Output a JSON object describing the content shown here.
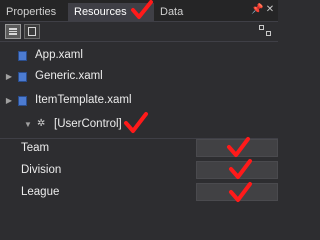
{
  "tabs": [
    {
      "label": "Properties"
    },
    {
      "label": "Resources"
    },
    {
      "label": "Data"
    }
  ],
  "window_controls": {
    "pin": "📌",
    "close": "✕"
  },
  "tree": {
    "items": [
      {
        "label": "App.xaml",
        "expander": ""
      },
      {
        "label": "Generic.xaml",
        "expander": "▶"
      },
      {
        "label": "ItemTemplate.xaml",
        "expander": "▶"
      },
      {
        "label": "[UserControl]",
        "expander": "▼"
      }
    ]
  },
  "properties": [
    {
      "label": "Team",
      "value": ""
    },
    {
      "label": "Division",
      "value": ""
    },
    {
      "label": "League",
      "value": ""
    }
  ],
  "colors": {
    "background": "#2d2d30",
    "annotation": "#ff1a1a",
    "file_icon": "#4c7bd1"
  }
}
